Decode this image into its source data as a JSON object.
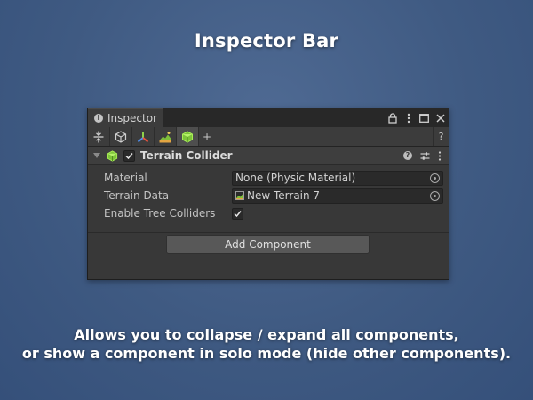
{
  "page": {
    "title": "Inspector Bar",
    "caption_line1": "Allows you to collapse / expand all components,",
    "caption_line2": "or show a component in solo mode (hide other components)."
  },
  "window": {
    "tab_label": "Inspector",
    "icons": [
      "info-icon",
      "lock-icon",
      "more-options-icon",
      "maximize-icon",
      "close-icon"
    ]
  },
  "toolbar": {
    "buttons": [
      {
        "name": "collapse-expand-all",
        "icon": "collapse-expand-icon"
      },
      {
        "name": "solo-transform",
        "icon": "transform-cube-icon"
      },
      {
        "name": "solo-axis-gizmo",
        "icon": "axis-gizmo-icon"
      },
      {
        "name": "solo-terrain",
        "icon": "terrain-icon"
      },
      {
        "name": "solo-terrain-collider",
        "icon": "terrain-collider-icon",
        "active": true
      }
    ],
    "add_label": "+",
    "help_label": "?"
  },
  "component": {
    "name": "Terrain Collider",
    "enabled": true,
    "icon": "terrain-collider-icon"
  },
  "properties": {
    "material": {
      "label": "Material",
      "value": "None (Physic Material)"
    },
    "terrain_data": {
      "label": "Terrain Data",
      "value": "New Terrain 7"
    },
    "enable_tree_colliders": {
      "label": "Enable Tree Colliders",
      "checked": true
    }
  },
  "add_component": {
    "label": "Add Component"
  },
  "colors": {
    "accent_green": "#9adf3a",
    "panel_bg": "#383838"
  }
}
